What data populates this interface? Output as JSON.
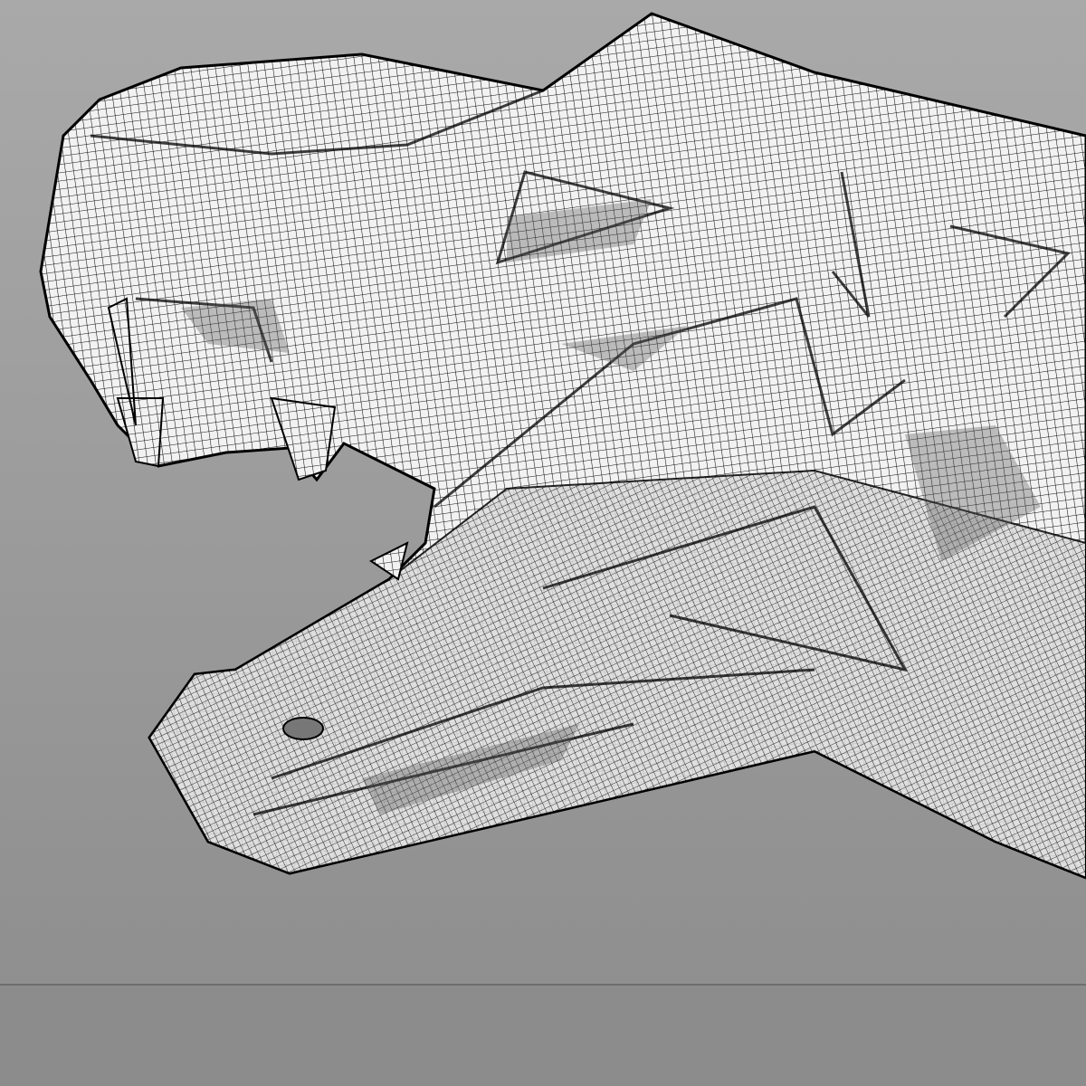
{
  "scene": {
    "subject": "wireframe-dinosaur-head",
    "colors": {
      "background_top": "#a9a9a9",
      "background_bottom": "#8f8f8f",
      "floor": "#8c8c8c",
      "horizon": "#6e6e6e",
      "mesh_fill": "#f2f2f2",
      "mesh_line": "#111111"
    }
  }
}
